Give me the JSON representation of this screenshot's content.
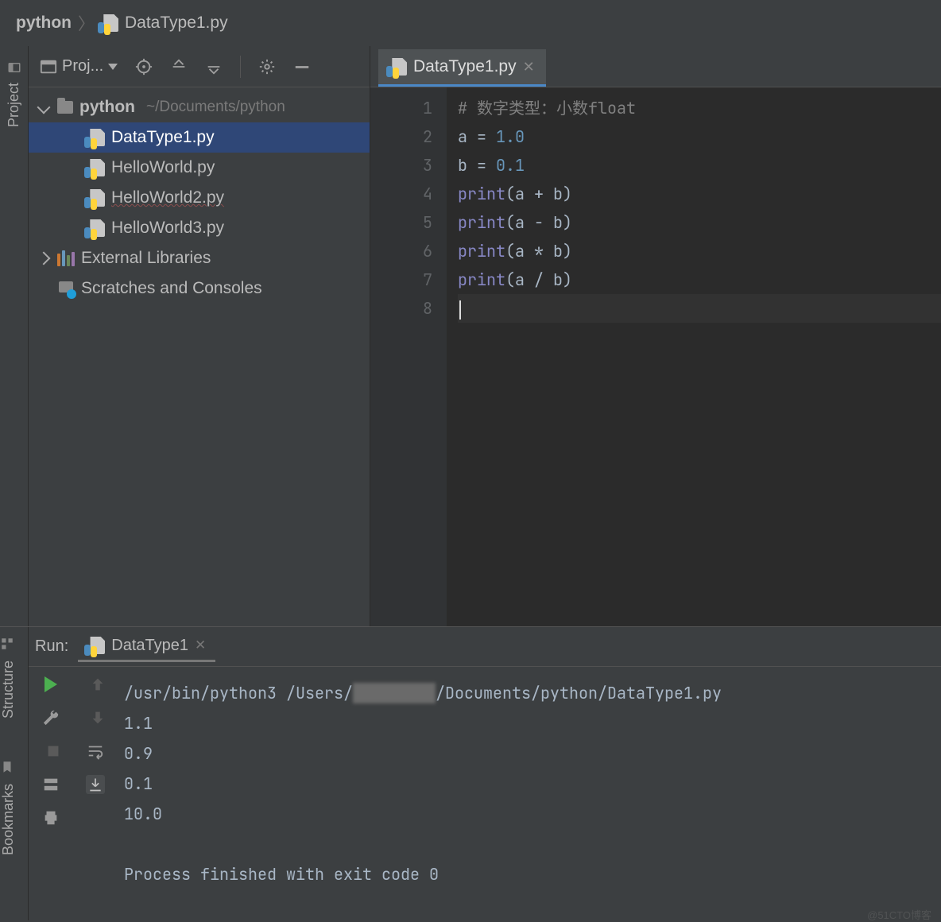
{
  "breadcrumb": {
    "root": "python",
    "file": "DataType1.py"
  },
  "sidebar": {
    "toolbar_label": "Proj...",
    "project": {
      "name": "python",
      "path": "~/Documents/python"
    },
    "files": [
      {
        "name": "DataType1.py",
        "selected": true,
        "warn": false
      },
      {
        "name": "HelloWorld.py",
        "selected": false,
        "warn": false
      },
      {
        "name": "HelloWorld2.py",
        "selected": false,
        "warn": true
      },
      {
        "name": "HelloWorld3.py",
        "selected": false,
        "warn": false
      }
    ],
    "external": "External Libraries",
    "scratches": "Scratches and Consoles"
  },
  "left_tools": {
    "project": "Project",
    "structure": "Structure",
    "bookmarks": "Bookmarks"
  },
  "editor": {
    "tab": "DataType1.py",
    "gutter": [
      "1",
      "2",
      "3",
      "4",
      "5",
      "6",
      "7",
      "8"
    ],
    "lines": [
      {
        "t": "comment",
        "text": "# 数字类型：小数float"
      },
      {
        "t": "assign",
        "var": "a",
        "val": "1.0"
      },
      {
        "t": "assign",
        "var": "b",
        "val": "0.1"
      },
      {
        "t": "call",
        "fn": "print",
        "arg": "a + b"
      },
      {
        "t": "call",
        "fn": "print",
        "arg": "a - b"
      },
      {
        "t": "call",
        "fn": "print",
        "arg": "a * b"
      },
      {
        "t": "call",
        "fn": "print",
        "arg": "a / b"
      },
      {
        "t": "caret"
      }
    ]
  },
  "run": {
    "label": "Run:",
    "tab": "DataType1",
    "cmd_pre": "/usr/bin/python3 /Users/",
    "cmd_post": "/Documents/python/DataType1.py",
    "out": [
      "1.1",
      "0.9",
      "0.1",
      "10.0",
      "",
      "Process finished with exit code 0"
    ]
  },
  "watermark": "@51CTO博客"
}
